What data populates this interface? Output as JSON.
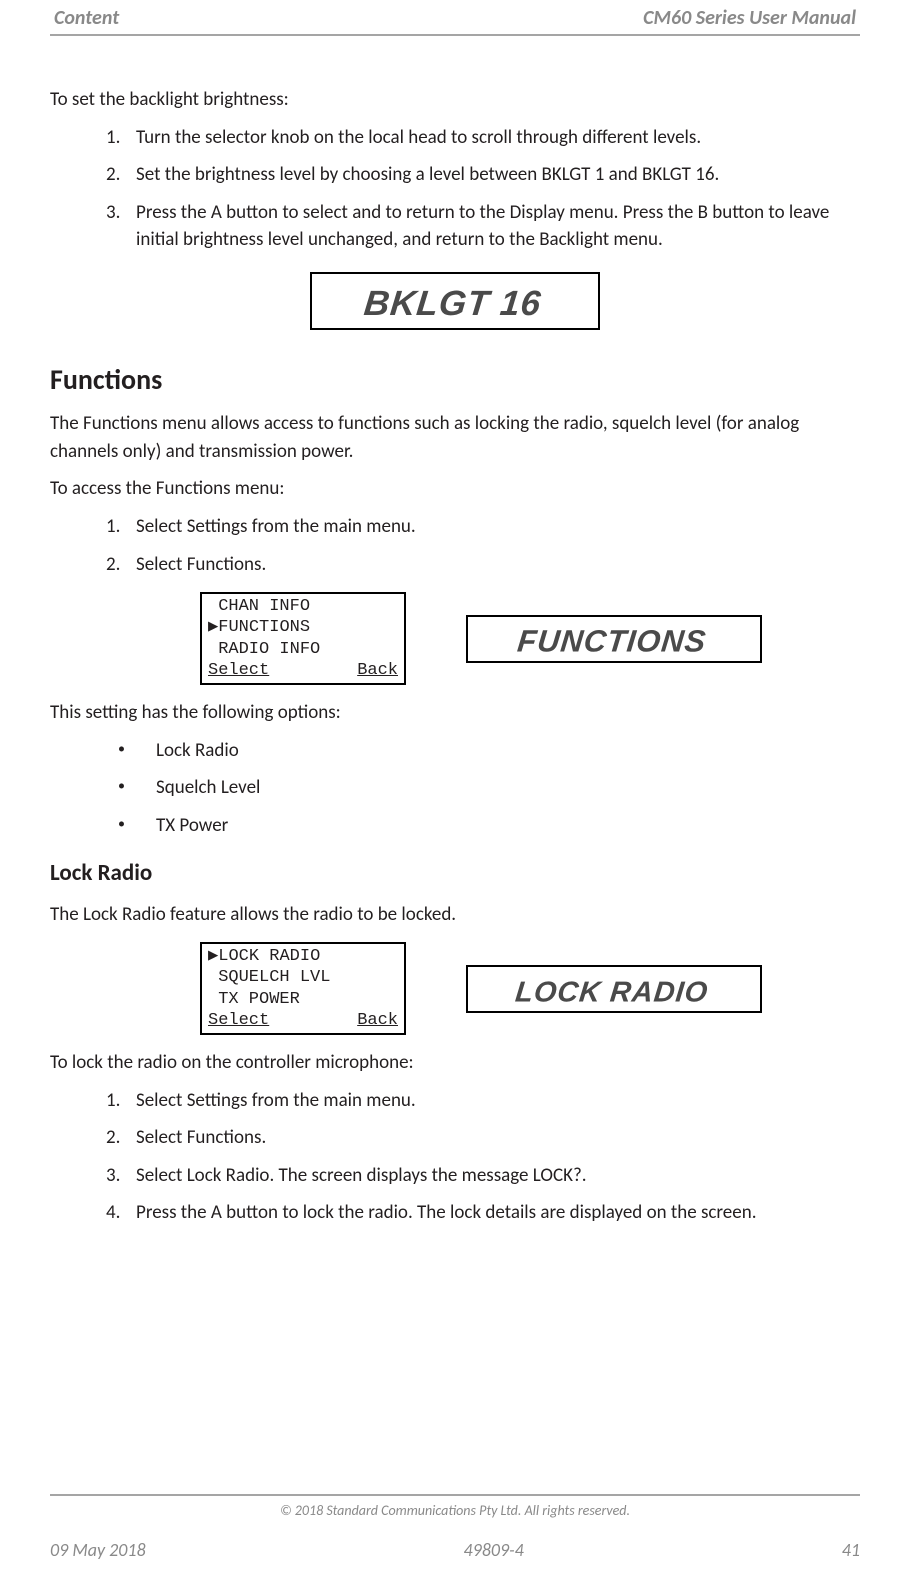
{
  "header": {
    "left": "Content",
    "right": "CM60 Series User Manual"
  },
  "backlight": {
    "intro": "To set the backlight brightness:",
    "steps": [
      "Turn the selector knob on the local head to scroll through different levels.",
      "Set the brightness level by choosing a level between BKLGT 1 and BKLGT 16.",
      "Press the A button to select and to return to the Display menu. Press the B button to leave initial brightness level unchanged, and return to the Backlight menu."
    ],
    "lcd": "BKLGT 16"
  },
  "functions": {
    "heading": "Functions",
    "desc": "The Functions menu allows access to functions such as locking the radio, squelch level (for analog channels only) and transmission power.",
    "access_intro": "To access the Functions menu:",
    "access_steps": [
      "Select Settings from the main menu.",
      "Select Functions."
    ],
    "menu": {
      "line1": " CHAN INFO",
      "line2_marker": "▶",
      "line2": "FUNCTIONS",
      "line3": " RADIO INFO",
      "select": "Select",
      "back": "Back"
    },
    "lcd": "FUNCTIONS",
    "options_intro": "This setting has the following options:",
    "options": [
      "Lock Radio",
      "Squelch Level",
      "TX Power"
    ]
  },
  "lockradio": {
    "heading": "Lock Radio",
    "desc": "The Lock Radio feature allows the radio to be locked.",
    "menu": {
      "line1_marker": "▶",
      "line1": "LOCK RADIO",
      "line2": " SQUELCH LVL",
      "line3": " TX POWER",
      "select": "Select",
      "back": "Back"
    },
    "lcd": "LOCK RADIO",
    "lock_intro": "To lock the radio on the controller microphone:",
    "lock_steps": [
      "Select Settings from the main menu.",
      "Select Functions.",
      "Select Lock Radio. The screen displays the message LOCK?.",
      "Press the A button to lock the radio. The lock details are displayed on the screen."
    ]
  },
  "footer": {
    "copyright": "© 2018 Standard Communications Pty Ltd. All rights reserved.",
    "date": "09 May 2018",
    "doc": "49809-4",
    "page": "41"
  }
}
